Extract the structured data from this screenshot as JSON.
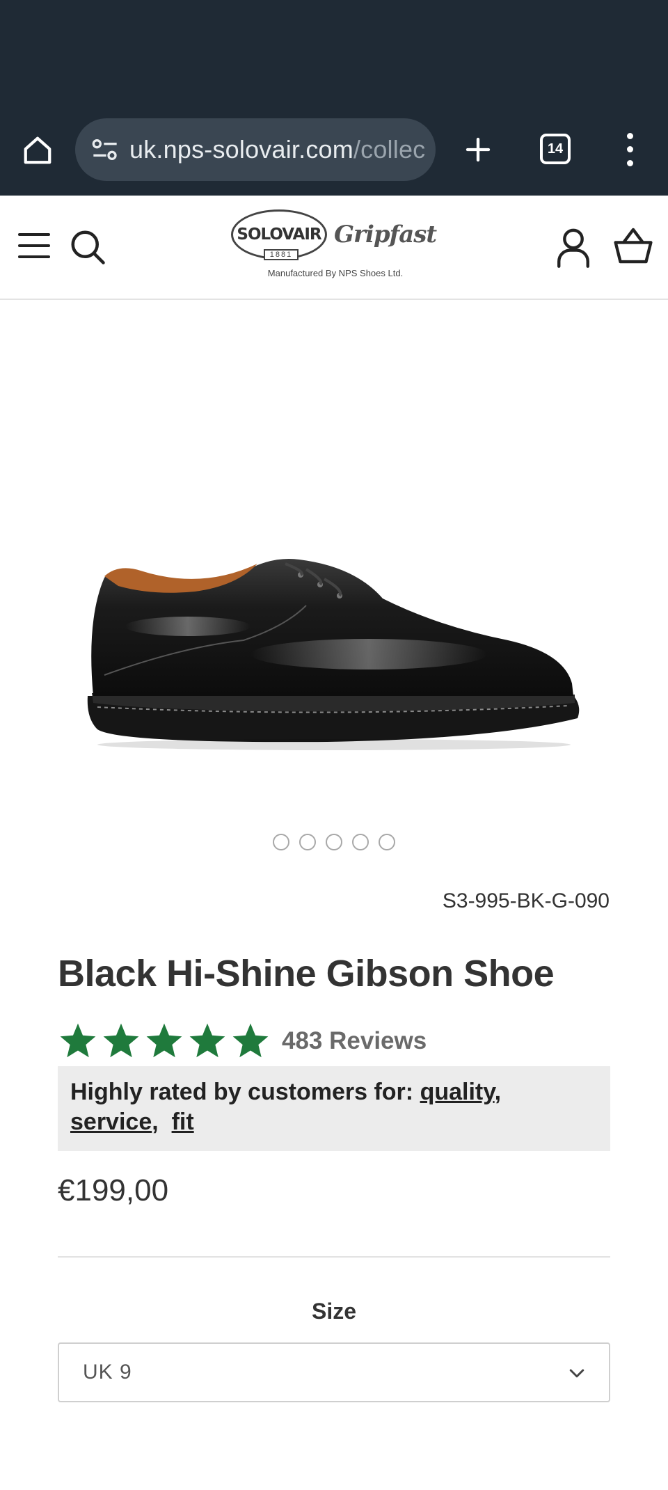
{
  "browser": {
    "url_domain": "uk.nps-solovair.com",
    "url_path": "/collec",
    "tab_count": "14",
    "icons": [
      "home-icon",
      "site-settings-icon",
      "new-tab-icon",
      "tab-switcher-icon",
      "more-vert-icon"
    ]
  },
  "header": {
    "logo_brand": "SOLOVAIR",
    "logo_year": "1881",
    "logo_script": "Gripfast",
    "tagline": "Manufactured By NPS Shoes Ltd.",
    "icons": [
      "hamburger-icon",
      "search-icon",
      "account-icon",
      "basket-icon"
    ]
  },
  "product": {
    "image_alt": "Black Hi-Shine Gibson Shoe",
    "carousel_total": 5,
    "sku": "S3-995-BK-G-090",
    "title": "Black Hi-Shine Gibson Shoe",
    "rating_stars": 5,
    "reviews_label": "483 Reviews",
    "highlights_prefix": "Highly rated by customers for:",
    "highlights": [
      "quality",
      "service",
      "fit"
    ],
    "price": "€199,00",
    "size_label": "Size",
    "size_value": "UK 9"
  },
  "colors": {
    "browser_bg": "#1f2a35",
    "url_pill": "#3a4652",
    "star_green": "#1f7a3c",
    "highlight_bg": "#ececec"
  }
}
